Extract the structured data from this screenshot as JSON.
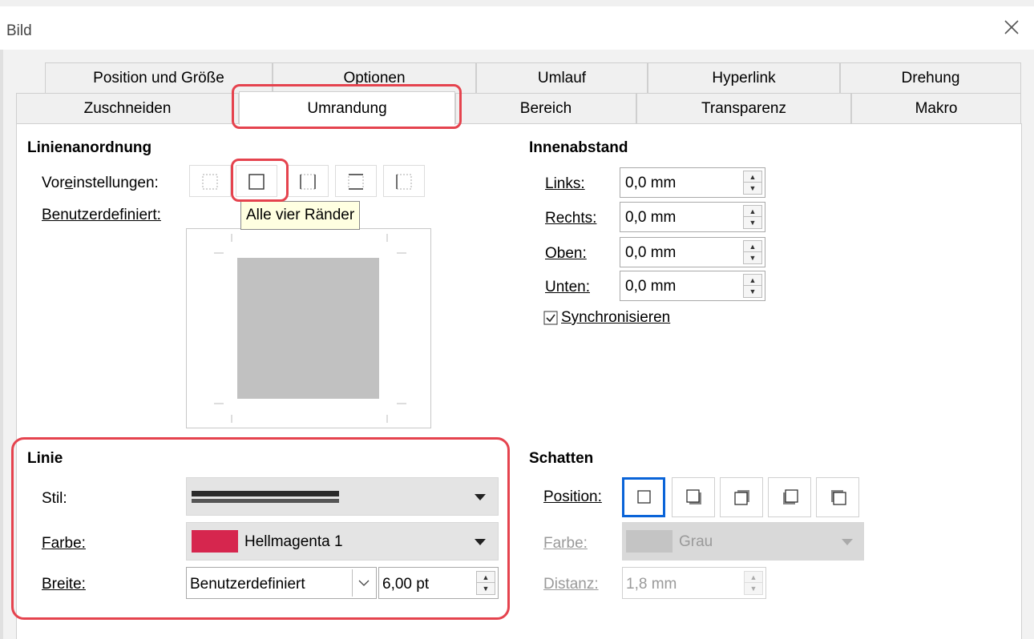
{
  "window": {
    "title": "Bild",
    "close_icon": "close-icon"
  },
  "tabs_row1": [
    "Position und Größe",
    "Optionen",
    "Umlauf",
    "Hyperlink",
    "Drehung"
  ],
  "tabs_row2": [
    "Zuschneiden",
    "Umrandung",
    "Bereich",
    "Transparenz",
    "Makro"
  ],
  "active_tab": "Umrandung",
  "line_arrangement": {
    "heading": "Linienanordnung",
    "presets_label": "Voreinstellungen:",
    "presets_access_key": "e",
    "user_defined_label": "Benutzerdefiniert:",
    "tooltip": "Alle vier Ränder"
  },
  "padding": {
    "heading": "Innenabstand",
    "left_label": "Links:",
    "left_value": "0,0 mm",
    "right_label": "Rechts:",
    "right_value": "0,0 mm",
    "top_label": "Oben:",
    "top_value": "0,0 mm",
    "bottom_label": "Unten:",
    "bottom_value": "0,0 mm",
    "sync_label": "Synchronisieren",
    "sync_checked": true
  },
  "line": {
    "heading": "Linie",
    "style_label": "Stil:",
    "color_label": "Farbe:",
    "color_value": "Hellmagenta 1",
    "color_swatch": "#d6264e",
    "width_label": "Breite:",
    "width_preset": "Benutzerdefiniert",
    "width_value": "6,00 pt"
  },
  "shadow": {
    "heading": "Schatten",
    "position_label": "Position:",
    "color_label": "Farbe:",
    "color_value": "Grau",
    "distance_label": "Distanz:",
    "distance_value": "1,8 mm"
  },
  "colors": {
    "accent": "#0a64d8",
    "highlight": "#e5434e",
    "tooltip_bg": "#ffffe1"
  }
}
